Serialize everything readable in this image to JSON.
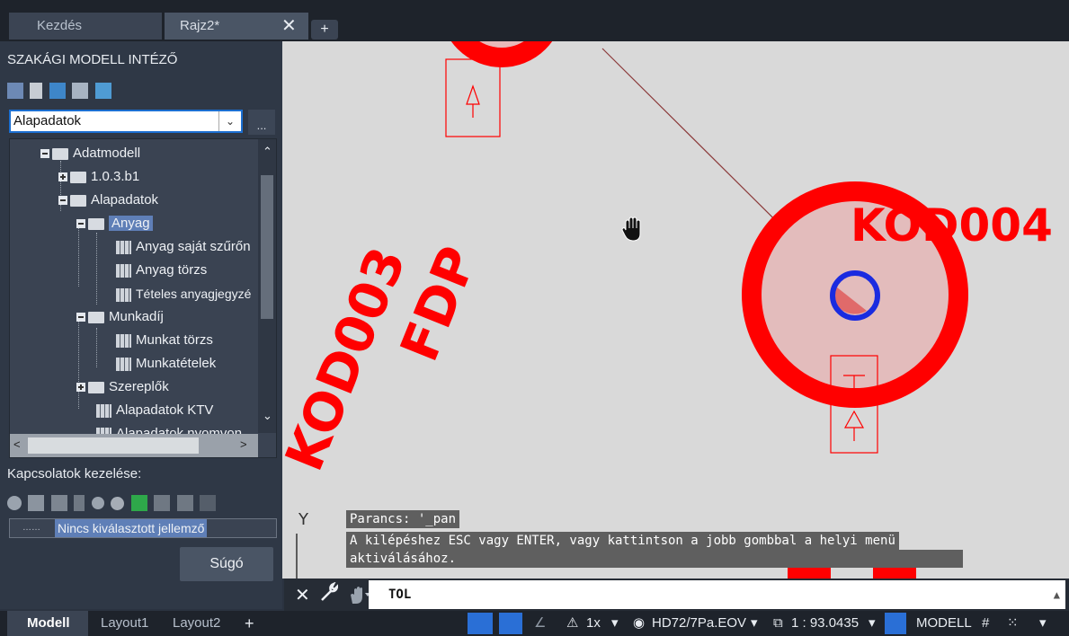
{
  "tabs": {
    "home": "Kezdés",
    "drawing": "Rajz2*",
    "close": "✕",
    "add": "+"
  },
  "palette": {
    "title": "SZAKÁGI MODELL INTÉZŐ",
    "dropdown_value": "Alapadatok",
    "dropdown_arrow": "⌄",
    "more_label": "...",
    "tree": [
      {
        "label": "Adatmodell",
        "kind": "folder",
        "expander": "minus"
      },
      {
        "label": "1.0.3.b1",
        "kind": "folder",
        "expander": "plus"
      },
      {
        "label": "Alapadatok",
        "kind": "folder",
        "expander": "minus"
      },
      {
        "label": "Anyag",
        "kind": "folder",
        "expander": "minus",
        "selected": true
      },
      {
        "label": "Anyag saját szűrőn",
        "kind": "table"
      },
      {
        "label": "Anyag törzs",
        "kind": "table"
      },
      {
        "label": "Tételes anyagjegyzé",
        "kind": "table"
      },
      {
        "label": "Munkadíj",
        "kind": "folder",
        "expander": "minus"
      },
      {
        "label": "Munkat törzs",
        "kind": "table"
      },
      {
        "label": "Munkatételek",
        "kind": "table"
      },
      {
        "label": "Szereplők",
        "kind": "folder",
        "expander": "plus"
      },
      {
        "label": "Alapadatok KTV",
        "kind": "table"
      },
      {
        "label": "Alapadatok nyomvon",
        "kind": "table"
      }
    ],
    "relations_title": "Kapcsolatok kezelése:",
    "relations_dash": "……",
    "relations_value": "Nincs kiválasztott jellemző",
    "help_button": "Súgó"
  },
  "canvas": {
    "label_kod003": "KOD003",
    "label_fdp": "FDP",
    "label_kod004": "KOD004",
    "ucs_y": "Y",
    "accent_red": "#ff0000",
    "accent_blue": "#1a2be0"
  },
  "command": {
    "history": [
      "Parancs: '_pan",
      "A kilépéshez ESC vagy ENTER, vagy kattintson a jobb gombbal a helyi menü",
      "aktiválásához."
    ],
    "input_label": "TOL",
    "close": "✕"
  },
  "status": {
    "tab_model": "Modell",
    "tab_layout1": "Layout1",
    "tab_layout2": "Layout2",
    "tab_add": "+",
    "scale": "1x",
    "coordsys": "HD72/7Pa.EOV",
    "annoscale": "1 : 93.0435",
    "model_label": "MODELL"
  }
}
